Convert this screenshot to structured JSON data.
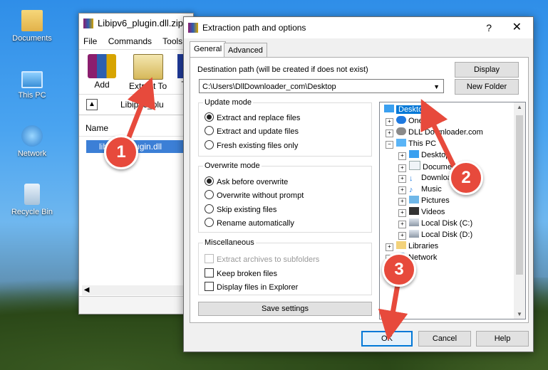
{
  "desktop": {
    "icons": [
      {
        "label": "Documents",
        "icon": "folder-icon"
      },
      {
        "label": "This PC",
        "icon": "computer-icon"
      },
      {
        "label": "Network",
        "icon": "network-icon"
      },
      {
        "label": "Recycle Bin",
        "icon": "recycle-bin-icon"
      }
    ]
  },
  "winrar": {
    "title": "Libipv6_plugin.dll.zip",
    "menu": [
      "File",
      "Commands",
      "Tools"
    ],
    "tools": [
      {
        "label": "Add"
      },
      {
        "label": "Extract To"
      },
      {
        "label": "T"
      }
    ],
    "path_text": "Libipv6_plu",
    "column_name": "Name",
    "selected_file": "libipv6_plugin.dll"
  },
  "dialog": {
    "title": "Extraction path and options",
    "help_glyph": "?",
    "close_glyph": "✕",
    "tabs": [
      "General",
      "Advanced"
    ],
    "dest_label": "Destination path (will be created if does not exist)",
    "dest_value": "C:\\Users\\DllDownloader_com\\Desktop",
    "display_button": "Display",
    "new_folder_button": "New Folder",
    "update_mode": {
      "title": "Update mode",
      "options": [
        "Extract and replace files",
        "Extract and update files",
        "Fresh existing files only"
      ],
      "selected": 0
    },
    "overwrite_mode": {
      "title": "Overwrite mode",
      "options": [
        "Ask before overwrite",
        "Overwrite without prompt",
        "Skip existing files",
        "Rename automatically"
      ],
      "selected": 0
    },
    "misc": {
      "title": "Miscellaneous",
      "options": [
        "Extract archives to subfolders",
        "Keep broken files",
        "Display files in Explorer"
      ]
    },
    "save_settings": "Save settings",
    "tree": [
      {
        "label": "Desktop",
        "selected": true
      },
      {
        "label": "OneD"
      },
      {
        "label": "DLL Downloader.com"
      },
      {
        "label": "This PC"
      },
      {
        "label": "Desktop"
      },
      {
        "label": "Documents"
      },
      {
        "label": "Downloads"
      },
      {
        "label": "Music"
      },
      {
        "label": "Pictures"
      },
      {
        "label": "Videos"
      },
      {
        "label": "Local Disk (C:)"
      },
      {
        "label": "Local Disk (D:)"
      },
      {
        "label": "Libraries"
      },
      {
        "label": "Network"
      }
    ],
    "ok": "OK",
    "cancel": "Cancel",
    "help": "Help"
  },
  "annotations": [
    "1",
    "2",
    "3"
  ],
  "colors": {
    "badge": "#e74a3c",
    "selection": "#0078d7",
    "ok_border": "#0078d7"
  }
}
